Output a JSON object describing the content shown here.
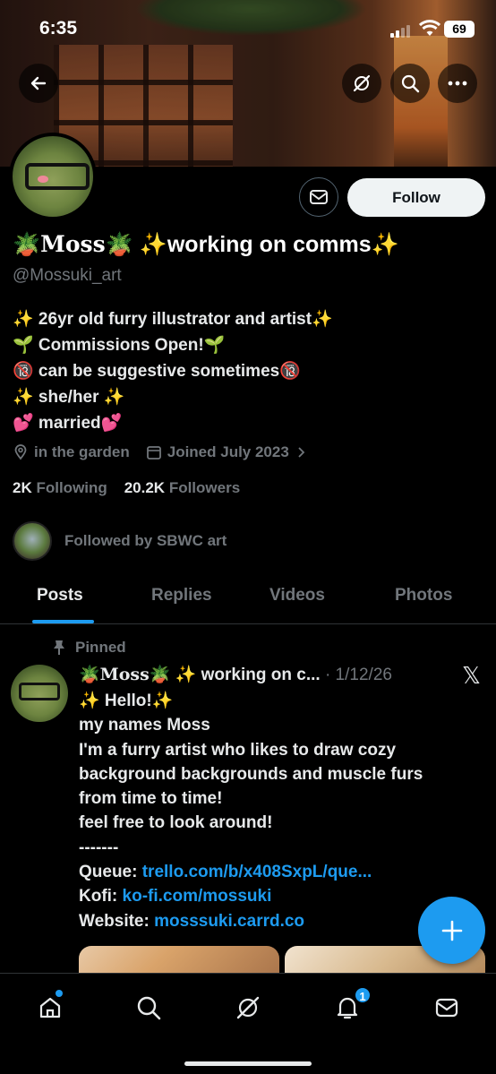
{
  "status_bar": {
    "time": "6:35",
    "battery": "69"
  },
  "profile": {
    "name_prefix_emoji": "🪴",
    "name_word": "Moss",
    "name_suffix_emoji": "🪴",
    "name_tail": "✨working on comms✨",
    "handle": "@Mossuki_art",
    "follow_label": "Follow",
    "bio": [
      "✨ 26yr old furry illustrator and artist✨",
      "🌱 Commissions Open!🌱",
      "🔞 can be suggestive sometimes🔞",
      "✨ she/her ✨",
      "💕 married💕"
    ],
    "location": "in the garden",
    "joined": "Joined July 2023",
    "following_count": "2K",
    "following_label": "Following",
    "followers_count": "20.2K",
    "followers_label": "Followers",
    "followed_by": "Followed by SBWC art"
  },
  "tabs": [
    "Posts",
    "Replies",
    "Videos",
    "Photos"
  ],
  "pinned_post": {
    "pinned_label": "Pinned",
    "author_name_emoji1": "🪴",
    "author_name_word": "Moss",
    "author_name_rest": "🪴 ✨ working on c...",
    "date": "· 1/12/26",
    "lines": [
      "✨ Hello!✨",
      "my names Moss",
      "I'm a furry artist who likes to draw cozy",
      "background backgrounds and muscle furs",
      "from time to time!",
      "feel free to look around!",
      "-------"
    ],
    "queue_label": "Queue:",
    "queue_link": "trello.com/b/x408SxpL/que...",
    "kofi_label": "Kofi:",
    "kofi_link": "ko-fi.com/mossuki",
    "website_label": "Website:",
    "website_link": "mosssuki.carrd.co"
  },
  "notifications_badge": "1",
  "colors": {
    "accent": "#1d9bf0",
    "muted": "#71767b",
    "text": "#e7e9ea"
  }
}
